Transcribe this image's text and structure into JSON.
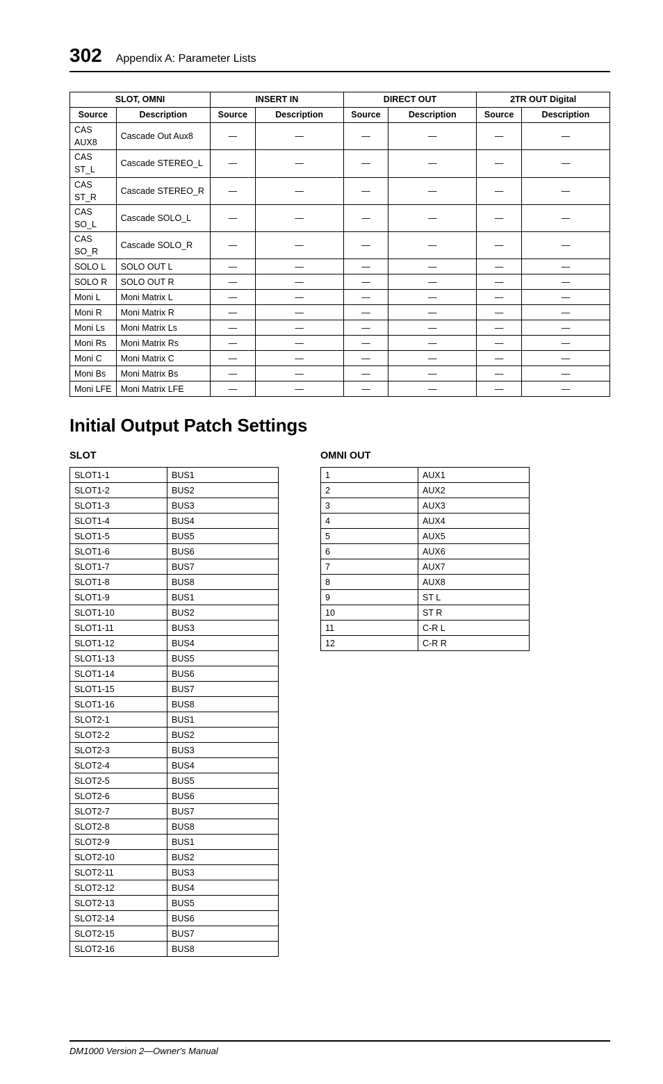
{
  "header": {
    "page_number": "302",
    "section": "Appendix A: Parameter Lists"
  },
  "table1": {
    "group_headers": [
      "SLOT, OMNI",
      "INSERT IN",
      "DIRECT OUT",
      "2TR OUT Digital"
    ],
    "sub_headers": [
      "Source",
      "Description",
      "Source",
      "Description",
      "Source",
      "Description",
      "Source",
      "Description"
    ],
    "rows": [
      {
        "source": "CAS AUX8",
        "desc": "Cascade Out Aux8"
      },
      {
        "source": "CAS ST_L",
        "desc": "Cascade STEREO_L"
      },
      {
        "source": "CAS ST_R",
        "desc": "Cascade STEREO_R"
      },
      {
        "source": "CAS SO_L",
        "desc": "Cascade SOLO_L"
      },
      {
        "source": "CAS SO_R",
        "desc": "Cascade SOLO_R"
      },
      {
        "source": "SOLO L",
        "desc": "SOLO OUT L"
      },
      {
        "source": "SOLO R",
        "desc": "SOLO OUT R"
      },
      {
        "source": "Moni L",
        "desc": "Moni Matrix L"
      },
      {
        "source": "Moni R",
        "desc": "Moni Matrix R"
      },
      {
        "source": "Moni Ls",
        "desc": "Moni Matrix Ls"
      },
      {
        "source": "Moni Rs",
        "desc": "Moni Matrix Rs"
      },
      {
        "source": "Moni C",
        "desc": "Moni Matrix C"
      },
      {
        "source": "Moni Bs",
        "desc": "Moni Matrix Bs"
      },
      {
        "source": "Moni LFE",
        "desc": "Moni Matrix LFE"
      }
    ],
    "dash": "—"
  },
  "main_heading": "Initial Output Patch Settings",
  "slot_heading": "SLOT",
  "omni_heading": "OMNI OUT",
  "slot_table": [
    [
      "SLOT1-1",
      "BUS1"
    ],
    [
      "SLOT1-2",
      "BUS2"
    ],
    [
      "SLOT1-3",
      "BUS3"
    ],
    [
      "SLOT1-4",
      "BUS4"
    ],
    [
      "SLOT1-5",
      "BUS5"
    ],
    [
      "SLOT1-6",
      "BUS6"
    ],
    [
      "SLOT1-7",
      "BUS7"
    ],
    [
      "SLOT1-8",
      "BUS8"
    ],
    [
      "SLOT1-9",
      "BUS1"
    ],
    [
      "SLOT1-10",
      "BUS2"
    ],
    [
      "SLOT1-11",
      "BUS3"
    ],
    [
      "SLOT1-12",
      "BUS4"
    ],
    [
      "SLOT1-13",
      "BUS5"
    ],
    [
      "SLOT1-14",
      "BUS6"
    ],
    [
      "SLOT1-15",
      "BUS7"
    ],
    [
      "SLOT1-16",
      "BUS8"
    ],
    [
      "SLOT2-1",
      "BUS1"
    ],
    [
      "SLOT2-2",
      "BUS2"
    ],
    [
      "SLOT2-3",
      "BUS3"
    ],
    [
      "SLOT2-4",
      "BUS4"
    ],
    [
      "SLOT2-5",
      "BUS5"
    ],
    [
      "SLOT2-6",
      "BUS6"
    ],
    [
      "SLOT2-7",
      "BUS7"
    ],
    [
      "SLOT2-8",
      "BUS8"
    ],
    [
      "SLOT2-9",
      "BUS1"
    ],
    [
      "SLOT2-10",
      "BUS2"
    ],
    [
      "SLOT2-11",
      "BUS3"
    ],
    [
      "SLOT2-12",
      "BUS4"
    ],
    [
      "SLOT2-13",
      "BUS5"
    ],
    [
      "SLOT2-14",
      "BUS6"
    ],
    [
      "SLOT2-15",
      "BUS7"
    ],
    [
      "SLOT2-16",
      "BUS8"
    ]
  ],
  "omni_table": [
    [
      "1",
      "AUX1"
    ],
    [
      "2",
      "AUX2"
    ],
    [
      "3",
      "AUX3"
    ],
    [
      "4",
      "AUX4"
    ],
    [
      "5",
      "AUX5"
    ],
    [
      "6",
      "AUX6"
    ],
    [
      "7",
      "AUX7"
    ],
    [
      "8",
      "AUX8"
    ],
    [
      "9",
      "ST L"
    ],
    [
      "10",
      "ST R"
    ],
    [
      "11",
      "C-R L"
    ],
    [
      "12",
      "C-R R"
    ]
  ],
  "footer": "DM1000 Version 2—Owner's Manual"
}
